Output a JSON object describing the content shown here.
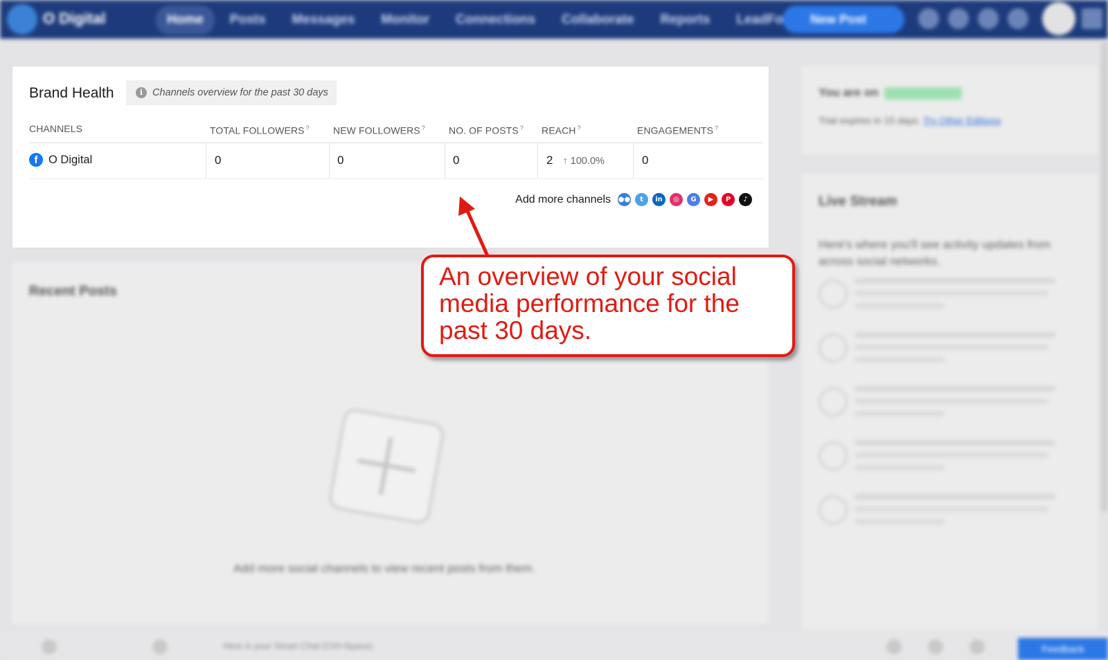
{
  "topbar": {
    "workspace": "O Digital",
    "nav_items": [
      "Home",
      "Posts",
      "Messages",
      "Monitor",
      "Connections",
      "Collaborate",
      "Reports",
      "LeadForms"
    ],
    "new_post_label": "New Post"
  },
  "brand_health": {
    "title": "Brand Health",
    "info_text": "Channels overview for the past 30 days",
    "columns": {
      "channels": "CHANNELS",
      "total_followers": "TOTAL FOLLOWERS",
      "new_followers": "NEW FOLLOWERS",
      "posts": "NO. OF POSTS",
      "reach": "REACH",
      "engagements": "ENGAGEMENTS"
    },
    "row": {
      "channel": "O Digital",
      "total_followers": "0",
      "new_followers": "0",
      "posts": "0",
      "reach": "2",
      "reach_change": "100.0%",
      "engagements": "0"
    },
    "add_more_label": "Add more channels",
    "social_icons": [
      "groups-icon",
      "twitter-icon",
      "linkedin-icon",
      "instagram-icon",
      "google-icon",
      "youtube-icon",
      "pinterest-icon",
      "tiktok-icon"
    ],
    "colors": {
      "facebook": "#1877f2",
      "reach_up": "#2fa84f"
    }
  },
  "recent_posts": {
    "title": "Recent Posts",
    "empty_text": "Add more social channels to view recent posts from them."
  },
  "sidebar": {
    "plan_label": "You are on",
    "trial_text": "Trial expires in 15 days.",
    "trial_link": "Try Other Editions",
    "live_stream_title": "Live Stream",
    "live_stream_sub": "Here's where you'll see activity updates from across social networks."
  },
  "bottombar": {
    "search_placeholder": "Here is your Smart Chat (Ctrl+Space)",
    "feedback_label": "Feedback"
  },
  "annotation": {
    "text": "An overview of your social media performance for the past 30 days.",
    "color": "#e01b12"
  }
}
